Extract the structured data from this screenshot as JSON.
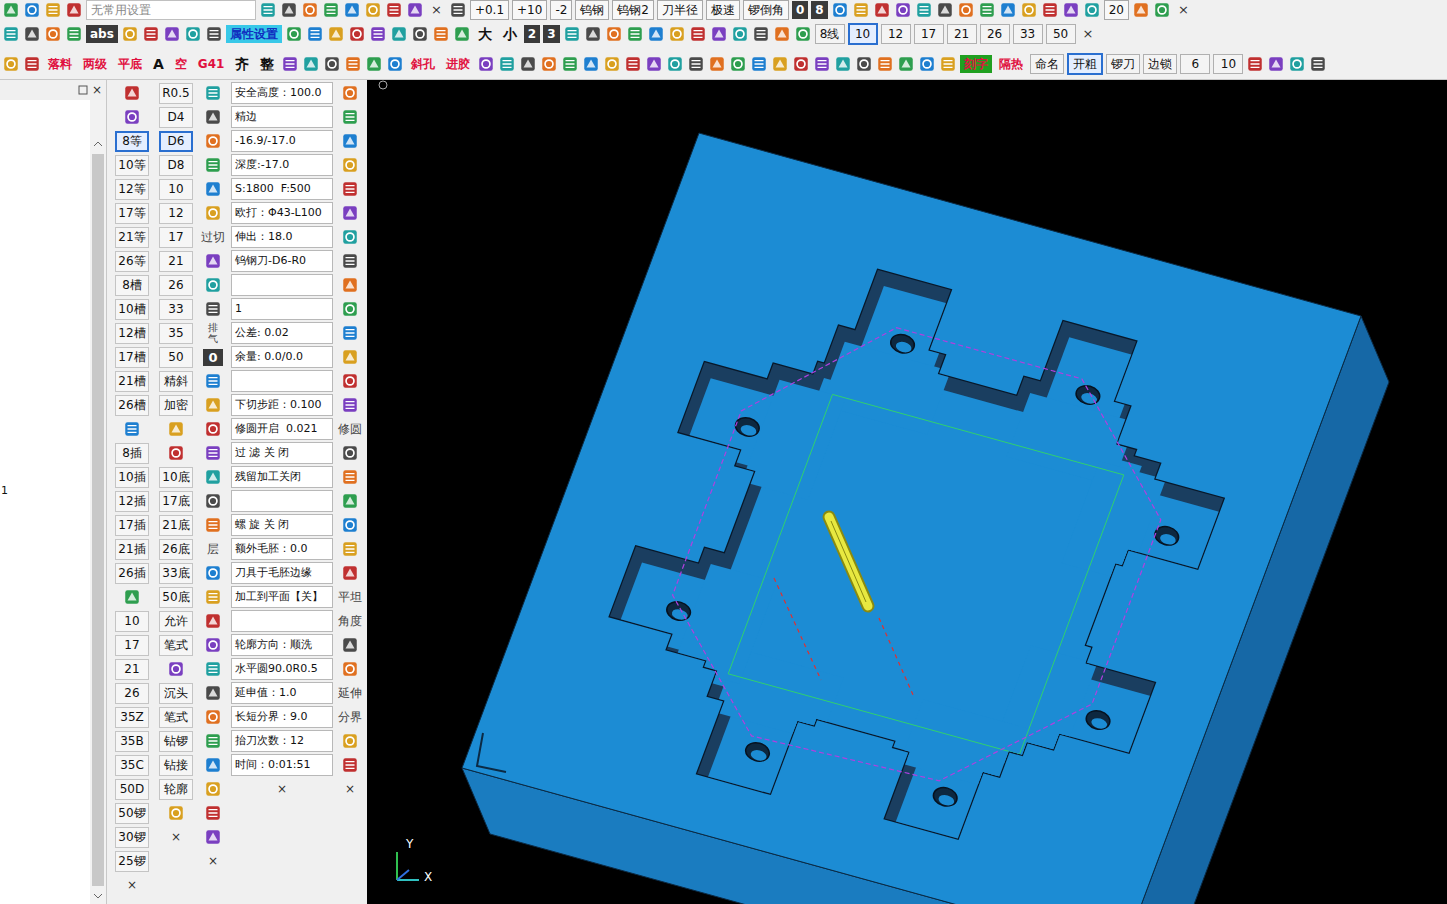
{
  "toolbars": [
    {
      "name": "toolbar-1",
      "items": [
        {
          "kind": "icon"
        },
        {
          "kind": "icon"
        },
        {
          "kind": "icon"
        },
        {
          "kind": "icon"
        },
        {
          "kind": "dropdown",
          "label": "无常用设置"
        },
        {
          "kind": "icon"
        },
        {
          "kind": "icon"
        },
        {
          "kind": "icon"
        },
        {
          "kind": "icon"
        },
        {
          "kind": "icon"
        },
        {
          "kind": "icon"
        },
        {
          "kind": "icon"
        },
        {
          "kind": "icon"
        },
        {
          "kind": "close",
          "label": "×"
        },
        {
          "kind": "icon"
        },
        {
          "kind": "btn",
          "label": "+0.1"
        },
        {
          "kind": "btn",
          "label": "+10"
        },
        {
          "kind": "btn",
          "label": "-2"
        },
        {
          "kind": "btn",
          "label": "钨钢"
        },
        {
          "kind": "btn",
          "label": "钨钢2"
        },
        {
          "kind": "btn",
          "label": "刀半径"
        },
        {
          "kind": "btn",
          "label": "极速"
        },
        {
          "kind": "btn",
          "label": "锣倒角"
        },
        {
          "kind": "dark",
          "label": "0"
        },
        {
          "kind": "dark",
          "label": "8"
        },
        {
          "kind": "icon"
        },
        {
          "kind": "icon"
        },
        {
          "kind": "icon"
        },
        {
          "kind": "icon"
        },
        {
          "kind": "icon"
        },
        {
          "kind": "icon"
        },
        {
          "kind": "icon"
        },
        {
          "kind": "icon"
        },
        {
          "kind": "icon"
        },
        {
          "kind": "icon"
        },
        {
          "kind": "icon"
        },
        {
          "kind": "icon"
        },
        {
          "kind": "icon"
        },
        {
          "kind": "btn",
          "label": "20"
        },
        {
          "kind": "icon"
        },
        {
          "kind": "icon"
        },
        {
          "kind": "close",
          "label": "×"
        }
      ]
    },
    {
      "name": "toolbar-2",
      "items": [
        {
          "kind": "icon"
        },
        {
          "kind": "icon"
        },
        {
          "kind": "icon"
        },
        {
          "kind": "icon"
        },
        {
          "kind": "dark",
          "label": "abs"
        },
        {
          "kind": "icon"
        },
        {
          "kind": "icon"
        },
        {
          "kind": "icon"
        },
        {
          "kind": "icon"
        },
        {
          "kind": "icon"
        },
        {
          "kind": "hl",
          "label": "属性设置"
        },
        {
          "kind": "icon"
        },
        {
          "kind": "icon"
        },
        {
          "kind": "icon"
        },
        {
          "kind": "icon"
        },
        {
          "kind": "icon"
        },
        {
          "kind": "icon"
        },
        {
          "kind": "icon"
        },
        {
          "kind": "icon"
        },
        {
          "kind": "icon"
        },
        {
          "kind": "plain",
          "label": "大"
        },
        {
          "kind": "plain",
          "label": "小"
        },
        {
          "kind": "dark",
          "label": "2"
        },
        {
          "kind": "dark",
          "label": "3"
        },
        {
          "kind": "icon"
        },
        {
          "kind": "icon"
        },
        {
          "kind": "icon"
        },
        {
          "kind": "icon"
        },
        {
          "kind": "icon"
        },
        {
          "kind": "icon"
        },
        {
          "kind": "icon"
        },
        {
          "kind": "icon"
        },
        {
          "kind": "icon"
        },
        {
          "kind": "icon"
        },
        {
          "kind": "icon"
        },
        {
          "kind": "icon"
        },
        {
          "kind": "tab",
          "label": "8线",
          "selected": false
        },
        {
          "kind": "tab",
          "label": "10",
          "selected": true
        },
        {
          "kind": "tab",
          "label": "12",
          "selected": false
        },
        {
          "kind": "tab",
          "label": "17",
          "selected": false
        },
        {
          "kind": "tab",
          "label": "21",
          "selected": false
        },
        {
          "kind": "tab",
          "label": "26",
          "selected": false
        },
        {
          "kind": "tab",
          "label": "33",
          "selected": false
        },
        {
          "kind": "tab",
          "label": "50",
          "selected": false
        },
        {
          "kind": "close",
          "label": "×"
        }
      ]
    },
    {
      "name": "toolbar-3",
      "items": [
        {
          "kind": "icon"
        },
        {
          "kind": "icon"
        },
        {
          "kind": "red",
          "label": "落料"
        },
        {
          "kind": "red",
          "label": "两级"
        },
        {
          "kind": "red",
          "label": "平底"
        },
        {
          "kind": "plain",
          "label": "A"
        },
        {
          "kind": "red",
          "label": "空"
        },
        {
          "kind": "red",
          "label": "G41"
        },
        {
          "kind": "plain",
          "label": "齐"
        },
        {
          "kind": "plain",
          "label": "整"
        },
        {
          "kind": "icon"
        },
        {
          "kind": "icon"
        },
        {
          "kind": "icon"
        },
        {
          "kind": "icon"
        },
        {
          "kind": "icon"
        },
        {
          "kind": "icon"
        },
        {
          "kind": "red",
          "label": "斜孔"
        },
        {
          "kind": "red",
          "label": "进胶"
        },
        {
          "kind": "icon"
        },
        {
          "kind": "icon"
        },
        {
          "kind": "icon"
        },
        {
          "kind": "icon"
        },
        {
          "kind": "icon"
        },
        {
          "kind": "icon"
        },
        {
          "kind": "icon"
        },
        {
          "kind": "icon"
        },
        {
          "kind": "icon"
        },
        {
          "kind": "icon"
        },
        {
          "kind": "icon"
        },
        {
          "kind": "icon"
        },
        {
          "kind": "icon"
        },
        {
          "kind": "icon"
        },
        {
          "kind": "icon"
        },
        {
          "kind": "icon"
        },
        {
          "kind": "icon"
        },
        {
          "kind": "icon"
        },
        {
          "kind": "icon"
        },
        {
          "kind": "icon"
        },
        {
          "kind": "icon"
        },
        {
          "kind": "icon"
        },
        {
          "kind": "icon"
        },
        {
          "kind": "green",
          "label": "刻字"
        },
        {
          "kind": "red",
          "label": "隔热"
        },
        {
          "kind": "tab",
          "label": "命名",
          "selected": false
        },
        {
          "kind": "tab",
          "label": "开粗",
          "selected": true
        },
        {
          "kind": "tab",
          "label": "锣刀",
          "selected": false
        },
        {
          "kind": "tab",
          "label": "边锁",
          "selected": false
        },
        {
          "kind": "tab",
          "label": "6",
          "selected": false
        },
        {
          "kind": "tab",
          "label": "10",
          "selected": false
        },
        {
          "kind": "icon"
        },
        {
          "kind": "icon"
        },
        {
          "kind": "icon"
        },
        {
          "kind": "icon"
        }
      ]
    }
  ],
  "tree_panel": {
    "close": "×",
    "items": [
      "1"
    ]
  },
  "column_1": [
    {
      "kind": "icon"
    },
    {
      "kind": "icon"
    },
    {
      "kind": "btn",
      "label": "8等",
      "selected": true
    },
    {
      "kind": "btn",
      "label": "10等",
      "selected": false
    },
    {
      "kind": "btn",
      "label": "12等",
      "selected": false
    },
    {
      "kind": "btn",
      "label": "17等",
      "selected": false
    },
    {
      "kind": "btn",
      "label": "21等",
      "selected": false
    },
    {
      "kind": "btn",
      "label": "26等",
      "selected": false
    },
    {
      "kind": "btn",
      "label": "8槽",
      "selected": false
    },
    {
      "kind": "btn",
      "label": "10槽",
      "selected": false
    },
    {
      "kind": "btn",
      "label": "12槽",
      "selected": false
    },
    {
      "kind": "btn",
      "label": "17槽",
      "selected": false
    },
    {
      "kind": "btn",
      "label": "21槽",
      "selected": false
    },
    {
      "kind": "btn",
      "label": "26槽",
      "selected": false
    },
    {
      "kind": "icon"
    },
    {
      "kind": "btn",
      "label": "8插",
      "selected": false
    },
    {
      "kind": "btn",
      "label": "10插",
      "selected": false
    },
    {
      "kind": "btn",
      "label": "12插",
      "selected": false
    },
    {
      "kind": "btn",
      "label": "17插",
      "selected": false
    },
    {
      "kind": "btn",
      "label": "21插",
      "selected": false
    },
    {
      "kind": "btn",
      "label": "26插",
      "selected": false
    },
    {
      "kind": "icon"
    },
    {
      "kind": "btn",
      "label": "10",
      "selected": false
    },
    {
      "kind": "btn",
      "label": "17",
      "selected": false
    },
    {
      "kind": "btn",
      "label": "21",
      "selected": false
    },
    {
      "kind": "btn",
      "label": "26",
      "selected": false
    },
    {
      "kind": "btn",
      "label": "35Z",
      "selected": false
    },
    {
      "kind": "btn",
      "label": "35B",
      "selected": false
    },
    {
      "kind": "btn",
      "label": "35C",
      "selected": false
    },
    {
      "kind": "btn",
      "label": "50D",
      "selected": false
    },
    {
      "kind": "btn",
      "label": "50锣",
      "selected": false
    },
    {
      "kind": "btn",
      "label": "30锣",
      "selected": false
    },
    {
      "kind": "btn",
      "label": "25锣",
      "selected": false
    },
    {
      "kind": "close",
      "label": "×"
    }
  ],
  "column_2": [
    {
      "kind": "btn",
      "label": "R0.5",
      "selected": false
    },
    {
      "kind": "btn",
      "label": "D4",
      "selected": false
    },
    {
      "kind": "btn",
      "label": "D6",
      "selected": true
    },
    {
      "kind": "btn",
      "label": "D8",
      "selected": false
    },
    {
      "kind": "btn",
      "label": "10",
      "selected": false
    },
    {
      "kind": "btn",
      "label": "12",
      "selected": false
    },
    {
      "kind": "btn",
      "label": "17",
      "selected": false
    },
    {
      "kind": "btn",
      "label": "21",
      "selected": false
    },
    {
      "kind": "btn",
      "label": "26",
      "selected": false
    },
    {
      "kind": "btn",
      "label": "33",
      "selected": false
    },
    {
      "kind": "btn",
      "label": "35",
      "selected": false
    },
    {
      "kind": "btn",
      "label": "50",
      "selected": false
    },
    {
      "kind": "btn",
      "label": "精斜",
      "selected": false
    },
    {
      "kind": "btn",
      "label": "加密",
      "selected": false
    },
    {
      "kind": "icon"
    },
    {
      "kind": "icon"
    },
    {
      "kind": "btn",
      "label": "10底",
      "selected": false
    },
    {
      "kind": "btn",
      "label": "17底",
      "selected": false
    },
    {
      "kind": "btn",
      "label": "21底",
      "selected": false
    },
    {
      "kind": "btn",
      "label": "26底",
      "selected": false
    },
    {
      "kind": "btn",
      "label": "33底",
      "selected": false
    },
    {
      "kind": "btn",
      "label": "50底",
      "selected": false
    },
    {
      "kind": "btn",
      "label": "允许",
      "selected": false
    },
    {
      "kind": "btn",
      "label": "笔式",
      "selected": false
    },
    {
      "kind": "icon"
    },
    {
      "kind": "btn",
      "label": "沉头",
      "selected": false
    },
    {
      "kind": "btn",
      "label": "笔式",
      "selected": false
    },
    {
      "kind": "btn",
      "label": "钻锣",
      "selected": false
    },
    {
      "kind": "btn",
      "label": "钻接",
      "selected": false
    },
    {
      "kind": "btn",
      "label": "轮廓",
      "selected": false
    },
    {
      "kind": "icon"
    },
    {
      "kind": "close",
      "label": "×"
    }
  ],
  "column_3": [
    {
      "kind": "icon"
    },
    {
      "kind": "icon"
    },
    {
      "kind": "icon"
    },
    {
      "kind": "icon"
    },
    {
      "kind": "icon"
    },
    {
      "kind": "icon"
    },
    {
      "kind": "text",
      "label": "过切"
    },
    {
      "kind": "icon"
    },
    {
      "kind": "icon"
    },
    {
      "kind": "icon"
    },
    {
      "kind": "vtext",
      "label": "排气"
    },
    {
      "kind": "dark",
      "label": "0"
    },
    {
      "kind": "icon"
    },
    {
      "kind": "icon"
    },
    {
      "kind": "icon"
    },
    {
      "kind": "icon"
    },
    {
      "kind": "icon"
    },
    {
      "kind": "icon"
    },
    {
      "kind": "icon"
    },
    {
      "kind": "text",
      "label": "层"
    },
    {
      "kind": "icon"
    },
    {
      "kind": "icon"
    },
    {
      "kind": "icon"
    },
    {
      "kind": "icon"
    },
    {
      "kind": "icon"
    },
    {
      "kind": "icon"
    },
    {
      "kind": "icon"
    },
    {
      "kind": "icon"
    },
    {
      "kind": "icon"
    },
    {
      "kind": "icon"
    },
    {
      "kind": "icon"
    },
    {
      "kind": "icon"
    },
    {
      "kind": "close",
      "label": "×"
    }
  ],
  "params": [
    "安全高度：100.0",
    "精边",
    "-16.9/-17.0",
    "深度:-17.0",
    "S:1800  F:500",
    "欧打：Φ43-L100",
    "伸出：18.0",
    "钨钢刀-D6-R0",
    "",
    "1",
    "公差: 0.02",
    "余量: 0.0/0.0",
    "",
    "下切步距：0.100",
    "修圆开启  0.021",
    "过 滤 关 闭",
    "残留加工关闭",
    "",
    "螺 旋 关 闭",
    "额外毛胚：0.0",
    "刀具于毛胚边缘",
    "加工到平面【关】",
    "",
    "轮廓方向：顺洗",
    "水平圆90.0R0.5",
    "延申值：1.0",
    "长短分界：9.0",
    "抬刀次数：12",
    "时间：0:01:51"
  ],
  "params_close": "×",
  "column_5": [
    {
      "kind": "icon"
    },
    {
      "kind": "icon"
    },
    {
      "kind": "icon"
    },
    {
      "kind": "icon"
    },
    {
      "kind": "icon"
    },
    {
      "kind": "icon"
    },
    {
      "kind": "icon"
    },
    {
      "kind": "icon"
    },
    {
      "kind": "icon"
    },
    {
      "kind": "icon"
    },
    {
      "kind": "icon"
    },
    {
      "kind": "icon"
    },
    {
      "kind": "icon"
    },
    {
      "kind": "icon"
    },
    {
      "kind": "text",
      "label": "修圆"
    },
    {
      "kind": "icon"
    },
    {
      "kind": "icon"
    },
    {
      "kind": "icon"
    },
    {
      "kind": "icon"
    },
    {
      "kind": "icon"
    },
    {
      "kind": "icon"
    },
    {
      "kind": "text",
      "label": "平坦"
    },
    {
      "kind": "text",
      "label": "角度"
    },
    {
      "kind": "icon"
    },
    {
      "kind": "icon"
    },
    {
      "kind": "text",
      "label": "延伸"
    },
    {
      "kind": "text",
      "label": "分界"
    },
    {
      "kind": "icon"
    },
    {
      "kind": "icon"
    },
    {
      "kind": "close",
      "label": "×"
    }
  ],
  "viewport": {
    "axis_y": "Y",
    "axis_x": "X"
  }
}
